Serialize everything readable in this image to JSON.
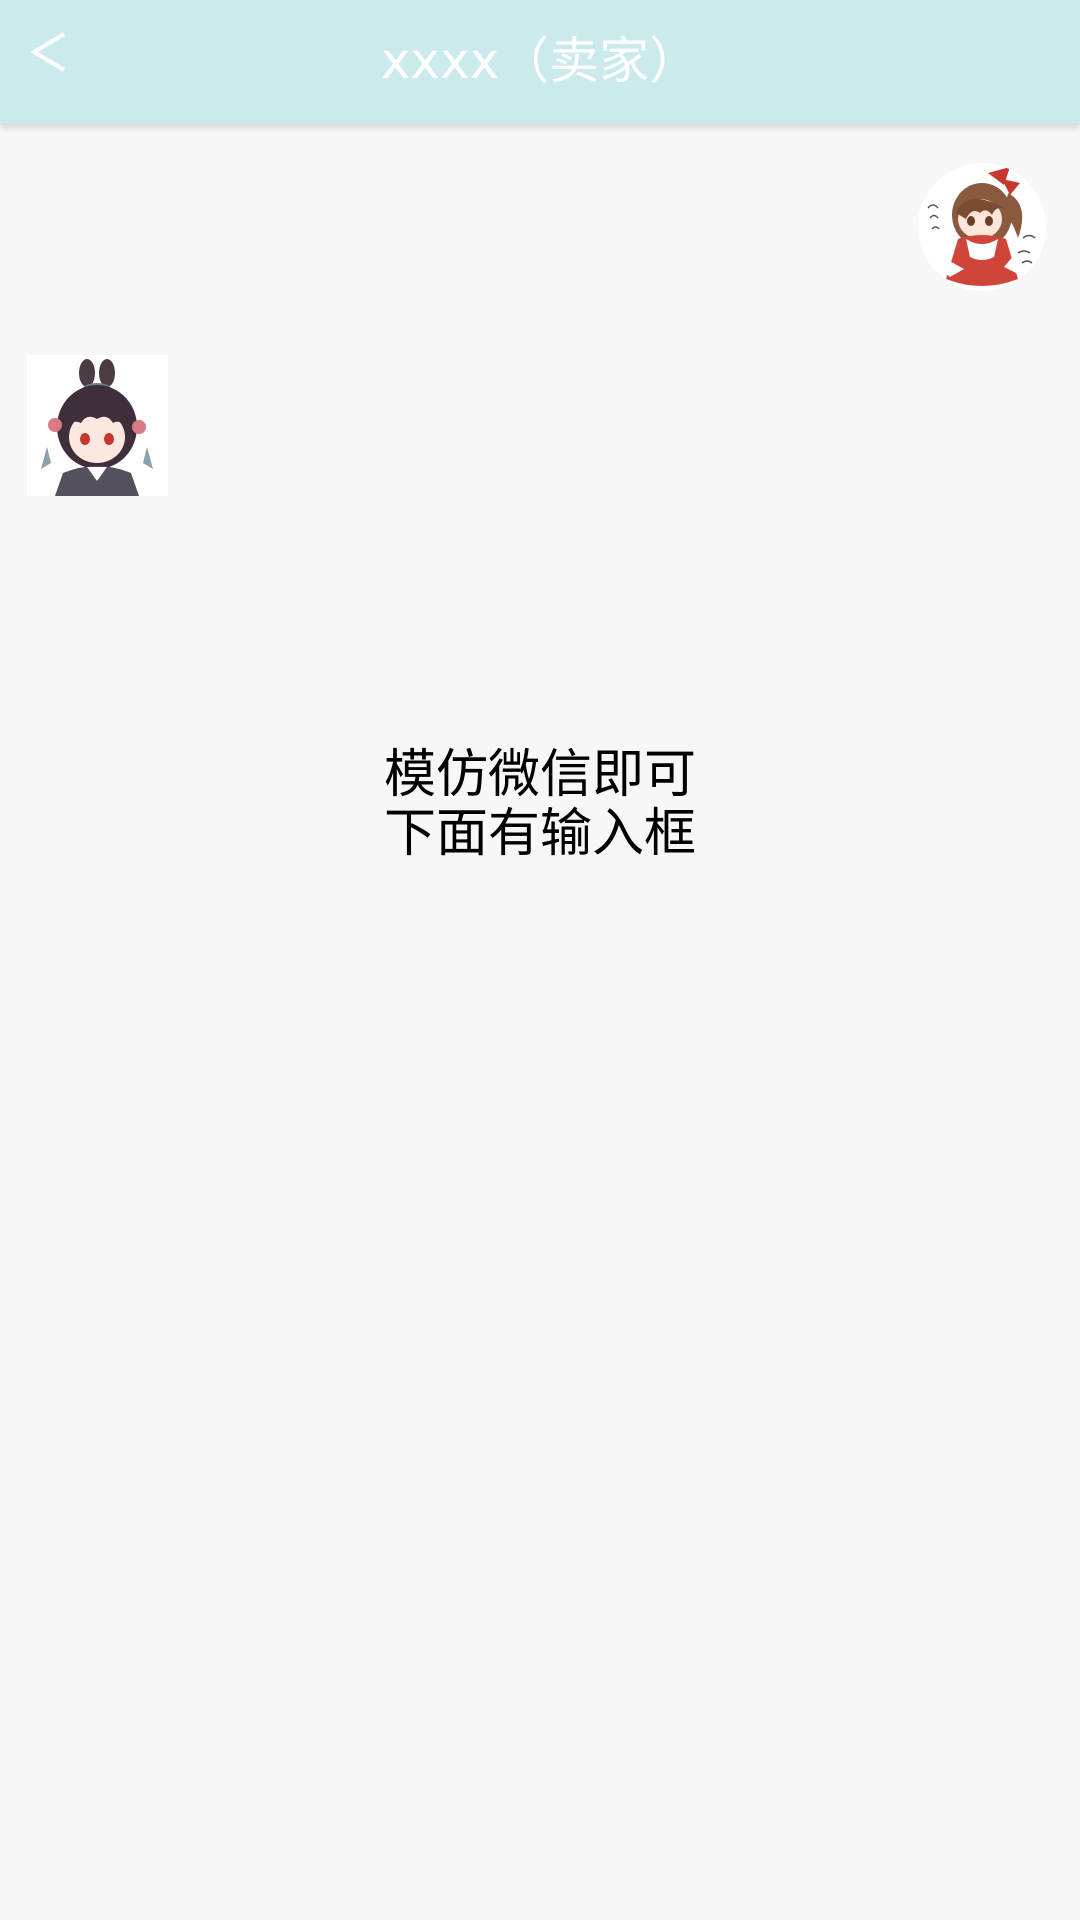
{
  "header": {
    "back_icon": "chevron-left-icon",
    "title": "xxxx（卖家）",
    "background": "#cbeaec",
    "text_color": "#ffffff"
  },
  "chat": {
    "self_avatar": "anime-girl-red-outfit-avatar",
    "other_avatar": "anime-girl-dark-hair-avatar"
  },
  "note": {
    "line1": "模仿微信即可",
    "line2": "下面有输入框"
  },
  "page_background": "#f7f7f7"
}
